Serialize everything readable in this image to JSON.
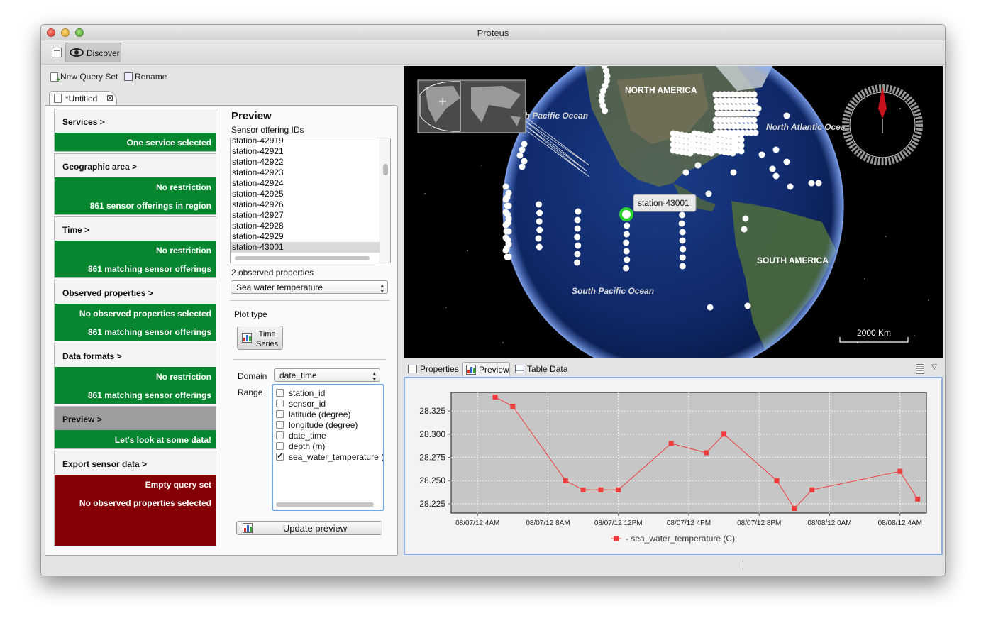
{
  "window": {
    "title": "Proteus"
  },
  "toolbar": {
    "perspective_label": "Discover"
  },
  "query_set": {
    "new_label": "New Query Set",
    "rename_label": "Rename",
    "tab_label": "*Untitled"
  },
  "steps": [
    {
      "title": "Services >",
      "status": "green",
      "lines": [
        "One service selected"
      ]
    },
    {
      "title": "Geographic area >",
      "status": "green",
      "lines": [
        "No restriction",
        "861 sensor offerings in region"
      ]
    },
    {
      "title": "Time >",
      "status": "green",
      "lines": [
        "No restriction",
        "861 matching sensor offerings"
      ]
    },
    {
      "title": "Observed properties >",
      "status": "green",
      "lines": [
        "No observed properties selected",
        "861 matching sensor offerings"
      ]
    },
    {
      "title": "Data formats >",
      "status": "green",
      "lines": [
        "No restriction",
        "861 matching sensor offerings"
      ]
    },
    {
      "title": "Preview >",
      "status": "green",
      "active": true,
      "lines": [
        "Let's look at some data!"
      ]
    },
    {
      "title": "Export sensor data >",
      "status": "red",
      "lines": [
        "Empty query set",
        "No observed properties selected"
      ]
    }
  ],
  "preview": {
    "title": "Preview",
    "offering_label": "Sensor offering IDs",
    "offerings": [
      "station-42919",
      "station-42921",
      "station-42922",
      "station-42923",
      "station-42924",
      "station-42925",
      "station-42926",
      "station-42927",
      "station-42928",
      "station-42929",
      "station-43001"
    ],
    "selected_offering": "station-43001",
    "observed_count_label": "2 observed properties",
    "observed_selected": "Sea water temperature",
    "plot_type_label": "Plot type",
    "plot_type_button": [
      "Time",
      "Series"
    ],
    "domain_label": "Domain",
    "domain_value": "date_time",
    "range_label": "Range",
    "range_items": [
      {
        "label": "station_id",
        "checked": false
      },
      {
        "label": "sensor_id",
        "checked": false
      },
      {
        "label": "latitude (degree)",
        "checked": false
      },
      {
        "label": "longitude (degree)",
        "checked": false
      },
      {
        "label": "date_time",
        "checked": false
      },
      {
        "label": "depth (m)",
        "checked": false
      },
      {
        "label": "sea_water_temperature (C",
        "checked": true
      }
    ],
    "update_button": "Update preview"
  },
  "map": {
    "labels": {
      "north_america": "NORTH AMERICA",
      "south_america": "SOUTH AMERICA",
      "north_pacific": "North Pacific Ocean",
      "north_atlantic": "North Atlantic Ocea",
      "south_pacific": "South Pacific Ocean"
    },
    "tooltip": "station-43001",
    "scale_label": "2000 Km",
    "compass": "compass-icon"
  },
  "bottom_tabs": [
    {
      "label": "Properties",
      "active": false
    },
    {
      "label": "Preview",
      "active": true
    },
    {
      "label": "Table Data",
      "active": false
    }
  ],
  "chart_data": {
    "type": "line",
    "x": [
      "08/07/12 5AM",
      "08/07/12 6AM",
      "08/07/12 9AM",
      "08/07/12 10AM",
      "08/07/12 11AM",
      "08/07/12 12PM",
      "08/07/12 3PM",
      "08/07/12 5PM",
      "08/07/12 6PM",
      "08/07/12 9PM",
      "08/07/12 10PM",
      "08/07/12 11PM",
      "08/08/12 4AM",
      "08/08/12 5AM"
    ],
    "series": [
      {
        "name": "- sea_water_temperature (C)",
        "values": [
          28.34,
          28.33,
          28.25,
          28.24,
          28.24,
          28.24,
          28.29,
          28.28,
          28.3,
          28.25,
          28.22,
          28.24,
          28.26,
          28.23
        ]
      }
    ],
    "x_ticks": [
      "08/07/12 4AM",
      "08/07/12 8AM",
      "08/07/12 12PM",
      "08/07/12 4PM",
      "08/07/12 8PM",
      "08/08/12 0AM",
      "08/08/12 4AM"
    ],
    "y_ticks": [
      "28.225",
      "28.250",
      "28.275",
      "28.300",
      "28.325"
    ],
    "ylim": [
      28.215,
      28.345
    ],
    "grid": true,
    "legend": "bottom",
    "colors": {
      "series": "#ee3b3b",
      "plot_bg": "#c6c6c6"
    }
  }
}
